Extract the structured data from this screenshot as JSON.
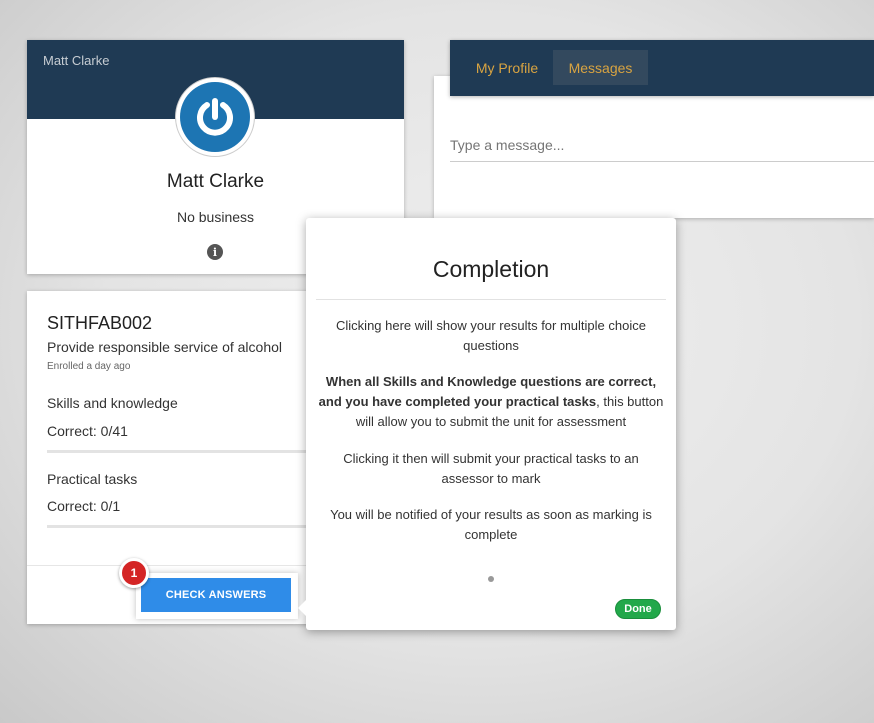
{
  "profile": {
    "header_name": "Matt Clarke",
    "name": "Matt Clarke",
    "business": "No business",
    "info_icon": "info-icon"
  },
  "tabs": [
    {
      "label": "My Profile",
      "active": false
    },
    {
      "label": "Messages",
      "active": true
    }
  ],
  "messages": {
    "input_placeholder": "Type a message..."
  },
  "unit": {
    "code": "SITHFAB002",
    "title": "Provide responsible service of alcohol",
    "enrolled": "Enrolled a day ago",
    "skills_label": "Skills and knowledge",
    "skills_correct": "Correct: 0/41",
    "practical_label": "Practical tasks",
    "practical_correct": "Correct: 0/1",
    "check_button": "CHECK ANSWERS"
  },
  "tour": {
    "step_number": "1",
    "title": "Completion",
    "para1": "Clicking here will show your results for multiple choice questions",
    "para2_bold1": "When all Skills and Knowledge questions are correct, and you have completed your practical tasks",
    "para2_rest": ", this button will allow you to submit the unit for assessment",
    "para3": "Clicking it then will submit your practical tasks to an assessor to mark",
    "para4": "You will be notified of your results as soon as marking is complete",
    "done_button": "Done"
  },
  "colors": {
    "header_bg": "#1f3a54",
    "tab_text": "#d9a441",
    "primary_button": "#2f8ce8",
    "badge": "#d42525",
    "done_button": "#22a84a",
    "avatar_ring": "#1d75b3"
  }
}
